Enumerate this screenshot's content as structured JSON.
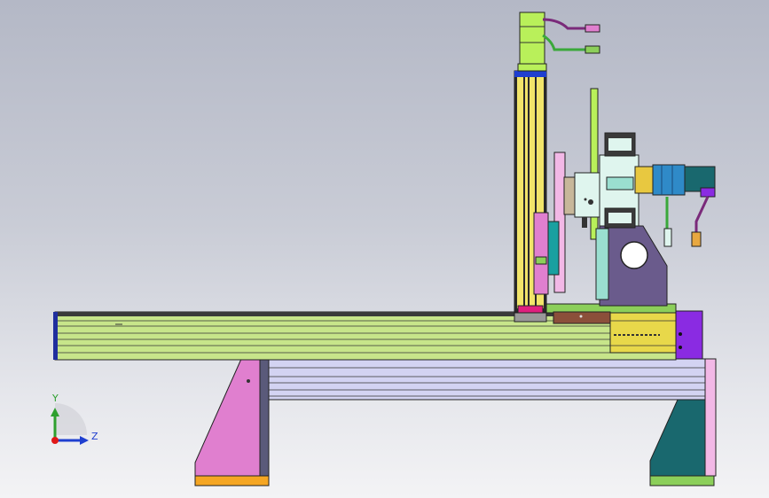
{
  "view": {
    "background_top": "#b4b8c6",
    "background_bottom": "#f3f3f5"
  },
  "triad": {
    "y_label": "Y",
    "z_label": "Z",
    "y_color": "#2ea02e",
    "z_color": "#1f3fd0",
    "x_color": "#e01818"
  },
  "assembly": {
    "colors": {
      "base_leg_left": "#e07fcf",
      "base_leg_right": "#19686e",
      "foot_left": "#f5a623",
      "foot_right": "#8ccf5a",
      "base_beam": "#d3d3f2",
      "x_rail": "#c7e58a",
      "column": "#f2e56a",
      "motor": "#b9f05a",
      "end_cap": "#8a2be2",
      "carriage_panel": "#f2b8e6",
      "bracket": "#6a5b8c",
      "head_body": "#dff5ee",
      "servo_motor": "#2f8ac8",
      "drive_block": "#e8d84a"
    }
  }
}
